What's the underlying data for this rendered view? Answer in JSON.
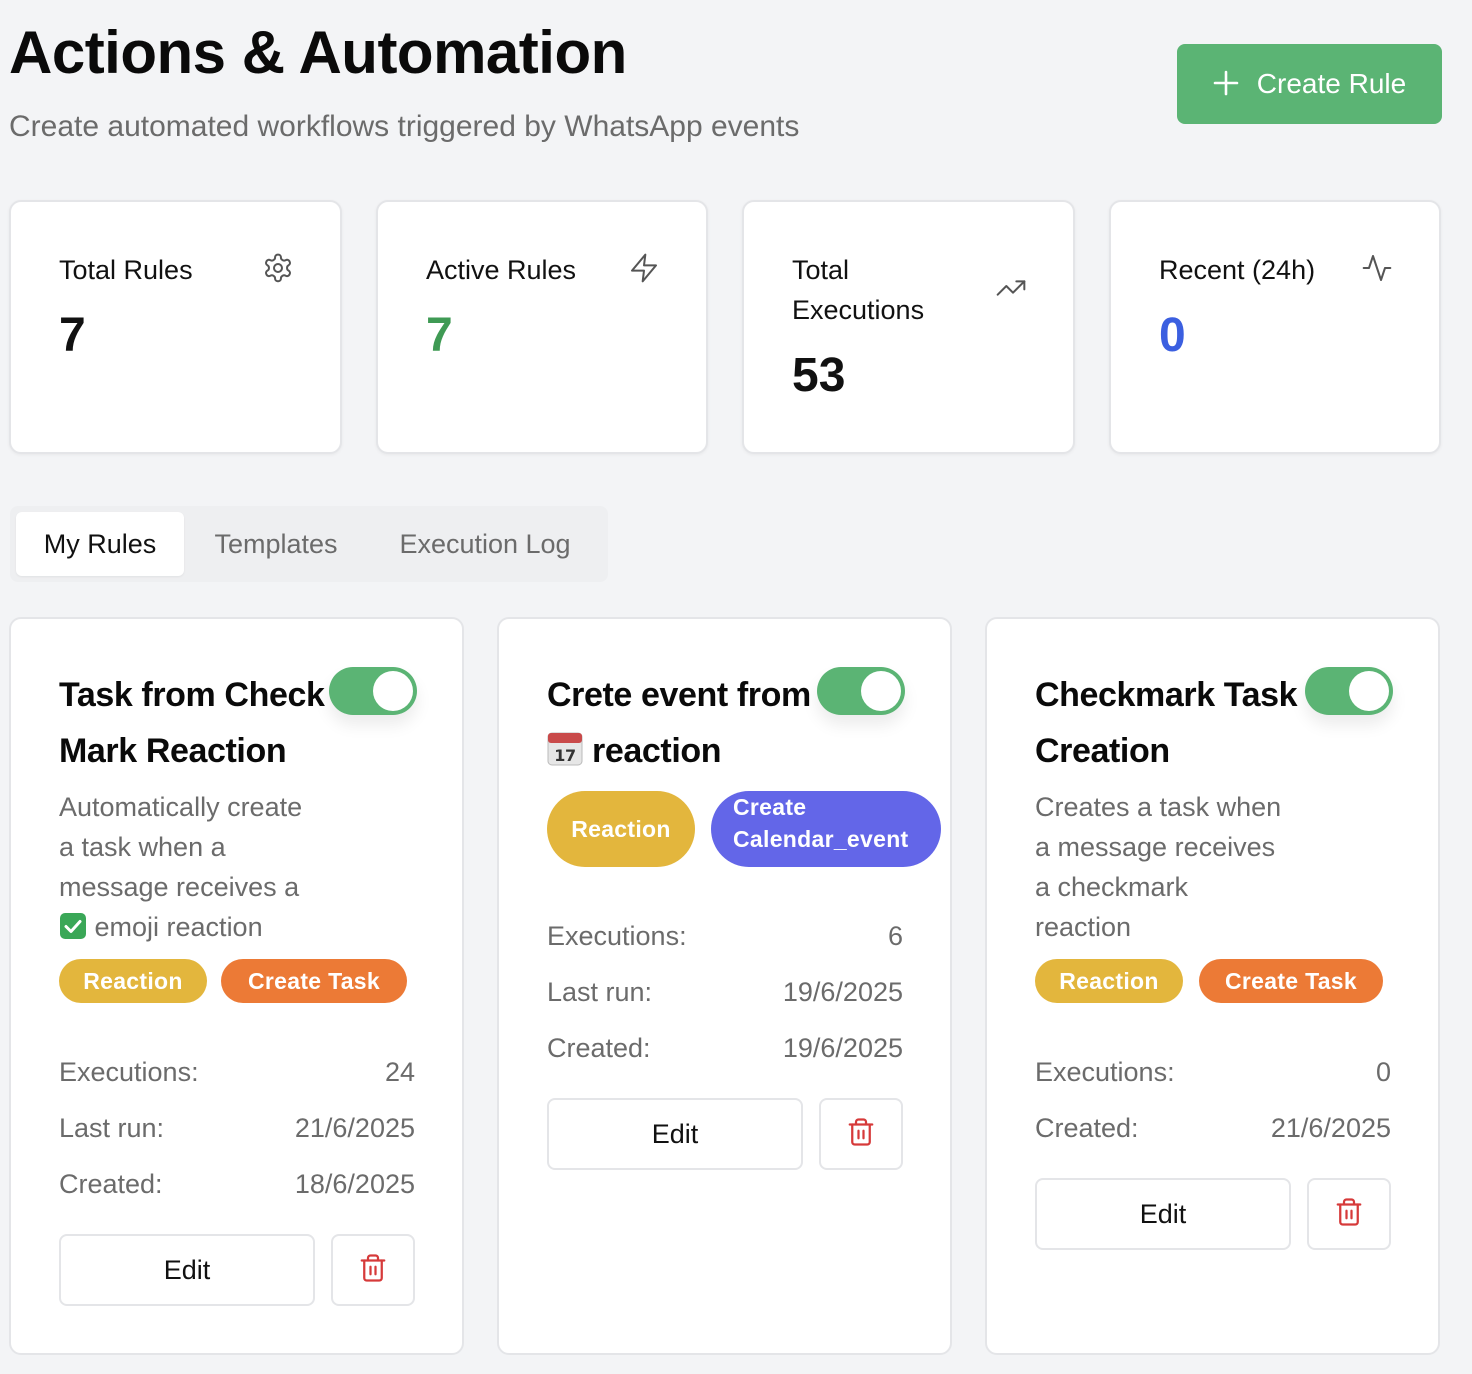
{
  "header": {
    "title": "Actions & Automation",
    "subtitle": "Create automated workflows triggered by WhatsApp events",
    "create_rule_label": "Create Rule"
  },
  "colors": {
    "accent_green": "#5bb474",
    "stat_green": "#3f9a54",
    "stat_blue": "#3b5fe0",
    "reaction_badge": "#e3b63d",
    "task_badge": "#ec7a36",
    "calendar_badge": "#6366e8",
    "delete_red": "#d63a3a"
  },
  "stats": [
    {
      "label": "Total Rules",
      "value": "7",
      "icon": "gear-icon"
    },
    {
      "label": "Active Rules",
      "value": "7",
      "icon": "lightning-icon"
    },
    {
      "label": "Total Executions",
      "value": "53",
      "icon": "trending-up-icon"
    },
    {
      "label": "Recent (24h)",
      "value": "0",
      "icon": "activity-icon"
    }
  ],
  "tabs": [
    {
      "label": "My Rules",
      "active": true
    },
    {
      "label": "Templates",
      "active": false
    },
    {
      "label": "Execution Log",
      "active": false
    }
  ],
  "rules": [
    {
      "title_line1": "Task from Check",
      "title_line2": "Mark Reaction",
      "enabled": true,
      "description_lines": [
        "Automatically create",
        "a task when a",
        "message receives a",
        "emoji reaction"
      ],
      "description_emoji": "check-mark-emoji",
      "badges": [
        "Reaction",
        "Create Task"
      ],
      "executions_label": "Executions:",
      "executions": "24",
      "last_run_label": "Last run:",
      "last_run": "21/6/2025",
      "created_label": "Created:",
      "created": "18/6/2025",
      "edit_label": "Edit"
    },
    {
      "title_line1": "Crete event from",
      "title_line2": "reaction",
      "title_emoji": "calendar-emoji",
      "enabled": true,
      "badges": [
        "Reaction",
        "Create",
        "Calendar_event"
      ],
      "executions_label": "Executions:",
      "executions": "6",
      "last_run_label": "Last run:",
      "last_run": "19/6/2025",
      "created_label": "Created:",
      "created": "19/6/2025",
      "edit_label": "Edit"
    },
    {
      "title_line1": "Checkmark Task",
      "title_line2": "Creation",
      "enabled": true,
      "description_lines": [
        "Creates a task when",
        "a message receives",
        "a checkmark",
        "reaction"
      ],
      "badges": [
        "Reaction",
        "Create Task"
      ],
      "executions_label": "Executions:",
      "executions": "0",
      "created_label": "Created:",
      "created": "21/6/2025",
      "edit_label": "Edit"
    }
  ]
}
